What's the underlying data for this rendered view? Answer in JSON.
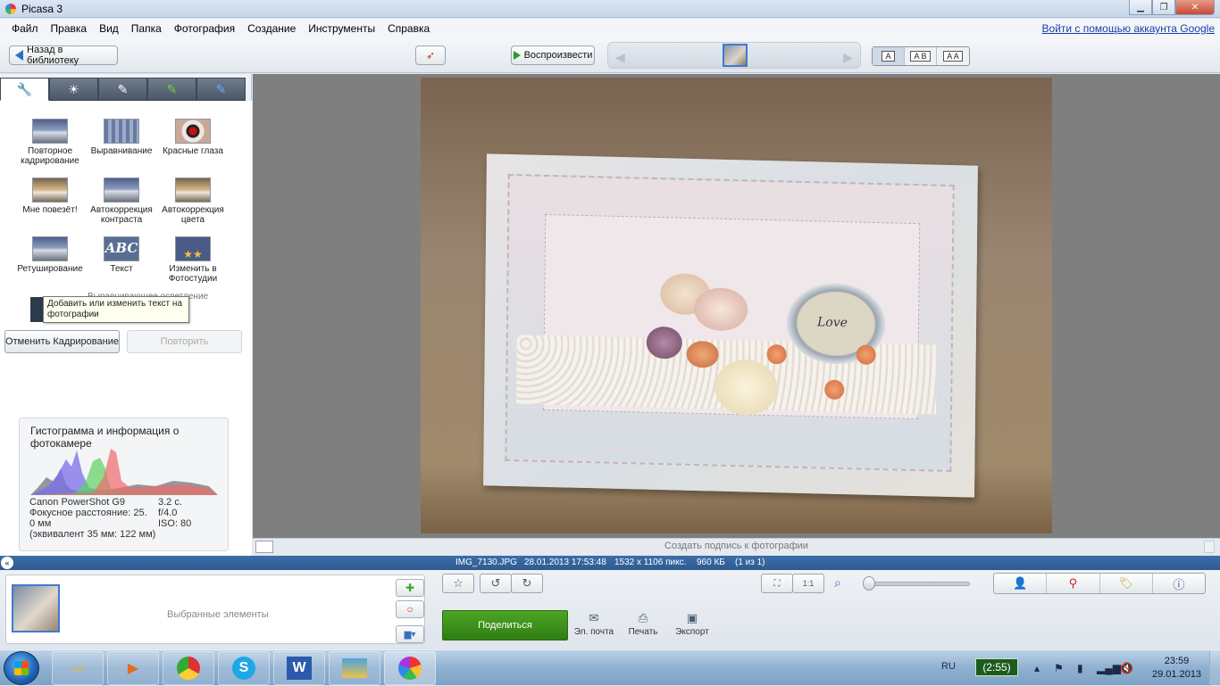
{
  "window": {
    "title": "Picasa 3"
  },
  "menu": {
    "items": [
      "Файл",
      "Правка",
      "Вид",
      "Папка",
      "Фотография",
      "Создание",
      "Инструменты",
      "Справка"
    ],
    "google_link": "Войти с помощью аккаунта Google"
  },
  "toolbar": {
    "back_label": "Назад в библиотеку",
    "play_label": "Воспроизвести",
    "view_modes": [
      "A",
      "A B",
      "A A"
    ]
  },
  "edit_tools": {
    "tabs": [
      "wrench-icon",
      "sun-icon",
      "brush-icon",
      "green-brush-icon",
      "blue-brush-icon"
    ],
    "items": [
      {
        "label": "Повторное кадрирование",
        "icon": "crop"
      },
      {
        "label": "Выравнивание",
        "icon": "grid"
      },
      {
        "label": "Красные глаза",
        "icon": "eye"
      },
      {
        "label": "Мне повезёт!",
        "icon": "warm"
      },
      {
        "label": "Автокоррекция контраста",
        "icon": "plain"
      },
      {
        "label": "Автокоррекция цвета",
        "icon": "warm"
      },
      {
        "label": "Ретуширование",
        "icon": "plain"
      },
      {
        "label": "Текст",
        "icon": "abc"
      },
      {
        "label": "Изменить в Фотостудии",
        "icon": "stars"
      }
    ],
    "hidden_item": "Выравнивающее осветление",
    "tooltip": "Добавить или изменить текст на фотографии",
    "undo_label": "Отменить Кадрирование",
    "redo_label": "Повторить",
    "abc_text": "ABC"
  },
  "histogram": {
    "title": "Гистограмма и информация о фотокамере",
    "camera": "Canon PowerShot G9",
    "focal": "Фокусное расстояние: 25.",
    "focal2": "0 мм",
    "equiv": "(эквивалент 35 мм: 122 мм)",
    "exposure": "3.2 с.",
    "aperture": "f/4.0",
    "iso": "ISO: 80"
  },
  "photo": {
    "caption_placeholder": "Создать подпись к фотографии",
    "card_text": "Love"
  },
  "info": {
    "filename": "IMG_7130.JPG",
    "datetime": "28.01.2013 17:53:48",
    "dimensions": "1532 x 1106 пикс.",
    "size": "960 КБ",
    "count": "(1 из 1)"
  },
  "bottom": {
    "tray_label": "Выбранные элементы",
    "share_label": "Поделиться",
    "email_label": "Эл. почта",
    "print_label": "Печать",
    "export_label": "Экспорт",
    "ratio_label": "1:1"
  },
  "taskbar": {
    "lang": "RU",
    "battery": "(2:55)",
    "time": "23:59",
    "date": "29.01.2013",
    "apps": [
      "explorer",
      "media-player",
      "chrome",
      "skype",
      "word",
      "photo-viewer",
      "picasa"
    ],
    "skype_letter": "S",
    "word_letter": "W"
  }
}
